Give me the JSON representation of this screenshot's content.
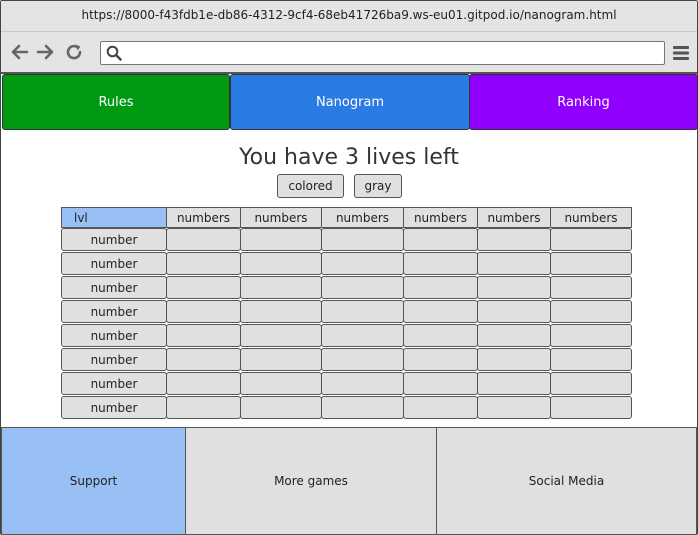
{
  "browser": {
    "url": "https://8000-f43fdb1e-db86-4312-9cf4-68eb41726ba9.ws-eu01.gitpod.io/nanogram.html",
    "search_value": "",
    "icons": [
      "back-arrow-icon",
      "forward-arrow-icon",
      "reload-icon",
      "search-icon",
      "hamburger-menu-icon"
    ]
  },
  "nav": {
    "tabs": [
      {
        "label": "Rules",
        "color": "#009a12"
      },
      {
        "label": "Nanogram",
        "color": "#2b7be5"
      },
      {
        "label": "Ranking",
        "color": "#9000ff"
      }
    ]
  },
  "game": {
    "lives_message": "You have 3 lives left",
    "modes": [
      "colored",
      "gray"
    ]
  },
  "grid": {
    "corner_label": "lvl",
    "column_headers": [
      "numbers",
      "numbers",
      "numbers",
      "numbers",
      "numbers",
      "numbers"
    ],
    "row_headers": [
      "number",
      "number",
      "number",
      "number",
      "number",
      "number",
      "number",
      "number"
    ],
    "highlight_color": "#99c0f5"
  },
  "footer": {
    "links": [
      {
        "label": "Support"
      },
      {
        "label": "More games"
      },
      {
        "label": "Social Media"
      }
    ]
  }
}
